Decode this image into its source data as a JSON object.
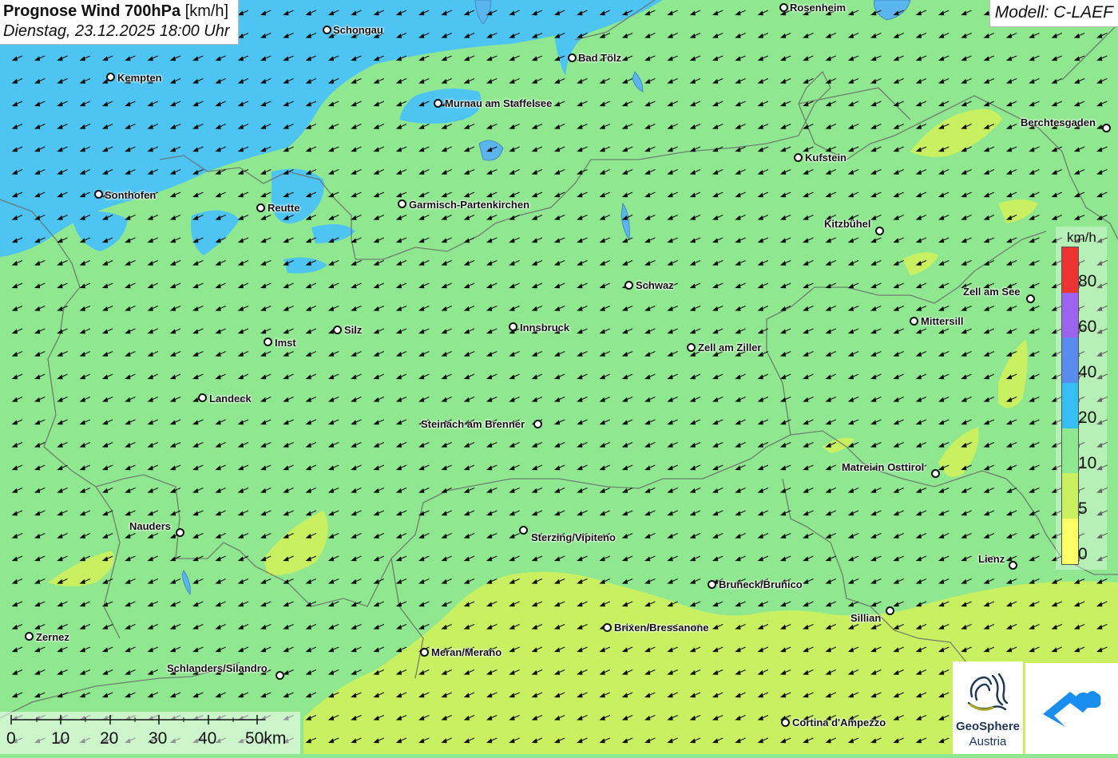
{
  "title": {
    "main": "Prognose Wind 700hPa",
    "unit": "[km/h]",
    "datetime": "Dienstag, 23.12.2025 18:00 Uhr"
  },
  "model": "Modell: C-LAEF",
  "legend": {
    "unit": "km/h",
    "labels": [
      "80",
      "60",
      "40",
      "20",
      "10",
      "5",
      "0"
    ],
    "colors": [
      "#ee3333",
      "#9b63ee",
      "#5a8cee",
      "#36bff2",
      "#8fe88f",
      "#c8f060",
      "#ffff66"
    ]
  },
  "scale": {
    "labels": [
      "0",
      "10",
      "20",
      "30",
      "40",
      "50km"
    ]
  },
  "logos": {
    "geosphere_line1": "GeoSphere",
    "geosphere_line2": "Austria"
  },
  "colors": {
    "field_main": "#8fe88f",
    "field_low": "#c8f060",
    "field_high": "#4dc4f2"
  },
  "cities": [
    {
      "name": "Rosenheim",
      "label": "Rosenheim"
    },
    {
      "name": "Schongau",
      "label": "Schongau"
    },
    {
      "name": "Bad Tölz",
      "label": "Bad Tölz"
    },
    {
      "name": "Kempten",
      "label": "Kempten"
    },
    {
      "name": "Murnau am Staffelsee",
      "label": "Murnau am Staffelsee"
    },
    {
      "name": "Berchtesgaden",
      "label": "Berchtesgaden"
    },
    {
      "name": "Kufstein",
      "label": "Kufstein"
    },
    {
      "name": "Sonthofen",
      "label": "Sonthofen"
    },
    {
      "name": "Reutte",
      "label": "Reutte"
    },
    {
      "name": "Garmisch-Partenkirchen",
      "label": "Garmisch-Partenkirchen"
    },
    {
      "name": "Kitzbühel",
      "label": "Kitzbühel"
    },
    {
      "name": "Schwaz",
      "label": "Schwaz"
    },
    {
      "name": "Zell am See",
      "label": "Zell am See"
    },
    {
      "name": "Mittersill",
      "label": "Mittersill"
    },
    {
      "name": "Innsbruck",
      "label": "Innsbruck"
    },
    {
      "name": "Silz",
      "label": "Silz"
    },
    {
      "name": "Imst",
      "label": "Imst"
    },
    {
      "name": "Zell am Ziller",
      "label": "Zell am Ziller"
    },
    {
      "name": "Landeck",
      "label": "Landeck"
    },
    {
      "name": "Steinach am Brenner",
      "label": "Steinach am Brenner"
    },
    {
      "name": "Matrei in Osttirol",
      "label": "Matrei in Osttirol"
    },
    {
      "name": "Nauders",
      "label": "Nauders"
    },
    {
      "name": "Sterzing/Vipiteno",
      "label": "Sterzing/Vipiteno"
    },
    {
      "name": "Lienz",
      "label": "Lienz"
    },
    {
      "name": "Bruneck/Brunico",
      "label": "Bruneck/Brunico"
    },
    {
      "name": "Sillian",
      "label": "Sillian"
    },
    {
      "name": "Brixen/Bressanone",
      "label": "Brixen/Bressanone"
    },
    {
      "name": "Zernez",
      "label": "Zernez"
    },
    {
      "name": "Meran/Merano",
      "label": "Meran/Merano"
    },
    {
      "name": "Schlanders/Silandro",
      "label": "Schlanders/Silandro"
    },
    {
      "name": "Cortina d'Ampezzo",
      "label": "Cortina d'Ampezzo"
    }
  ]
}
